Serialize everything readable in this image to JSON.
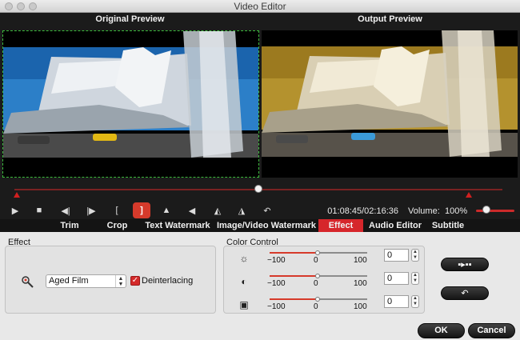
{
  "window": {
    "title": "Video Editor"
  },
  "preview": {
    "original_label": "Original Preview",
    "output_label": "Output Preview"
  },
  "player": {
    "timecode": "01:08:45/02:16:36",
    "volume_label": "Volume:",
    "volume_value": "100%",
    "playhead_fraction": 0.5,
    "volume_fraction": 1.0,
    "controls": [
      {
        "name": "play-icon",
        "glyph": "▶"
      },
      {
        "name": "stop-icon",
        "glyph": "■"
      },
      {
        "name": "previous-frame-icon",
        "glyph": "◀|"
      },
      {
        "name": "next-frame-icon",
        "glyph": "|▶"
      },
      {
        "name": "mark-in-icon",
        "glyph": "["
      },
      {
        "name": "mark-out-icon",
        "glyph": "]"
      },
      {
        "name": "flip-vertical-icon",
        "glyph": "▲"
      },
      {
        "name": "flip-horizontal-icon",
        "glyph": "◀"
      },
      {
        "name": "rotate-left-icon",
        "glyph": "◭"
      },
      {
        "name": "rotate-right-icon",
        "glyph": "◮"
      },
      {
        "name": "undo-icon",
        "glyph": "↶"
      }
    ]
  },
  "tabs": [
    "Trim",
    "Crop",
    "Text Watermark",
    "Image/Video Watermark",
    "Effect",
    "Audio Editor",
    "Subtitle"
  ],
  "active_tab": "Effect",
  "effect_panel": {
    "label": "Effect",
    "filter_value": "Aged Film",
    "deinterlacing_label": "Deinterlacing",
    "deinterlacing_checked": true
  },
  "color_control": {
    "label": "Color Control",
    "sliders": [
      {
        "name": "brightness",
        "icon": "sun-icon",
        "min": "−100",
        "mid": "0",
        "max": "100",
        "value": "0",
        "level": 0.5
      },
      {
        "name": "contrast",
        "icon": "contrast-icon",
        "min": "−100",
        "mid": "0",
        "max": "100",
        "value": "0",
        "level": 0.5
      },
      {
        "name": "saturation",
        "icon": "saturation-icon",
        "min": "−100",
        "mid": "0",
        "max": "100",
        "value": "0",
        "level": 0.5
      }
    ]
  },
  "buttons": {
    "apply_glyph": "▪▸▪▪",
    "reset_glyph": "↶",
    "ok": "OK",
    "cancel": "Cancel"
  },
  "colors": {
    "accent": "#d6262b",
    "panel": "#e8e8e8",
    "dark": "#1b1b1b"
  }
}
